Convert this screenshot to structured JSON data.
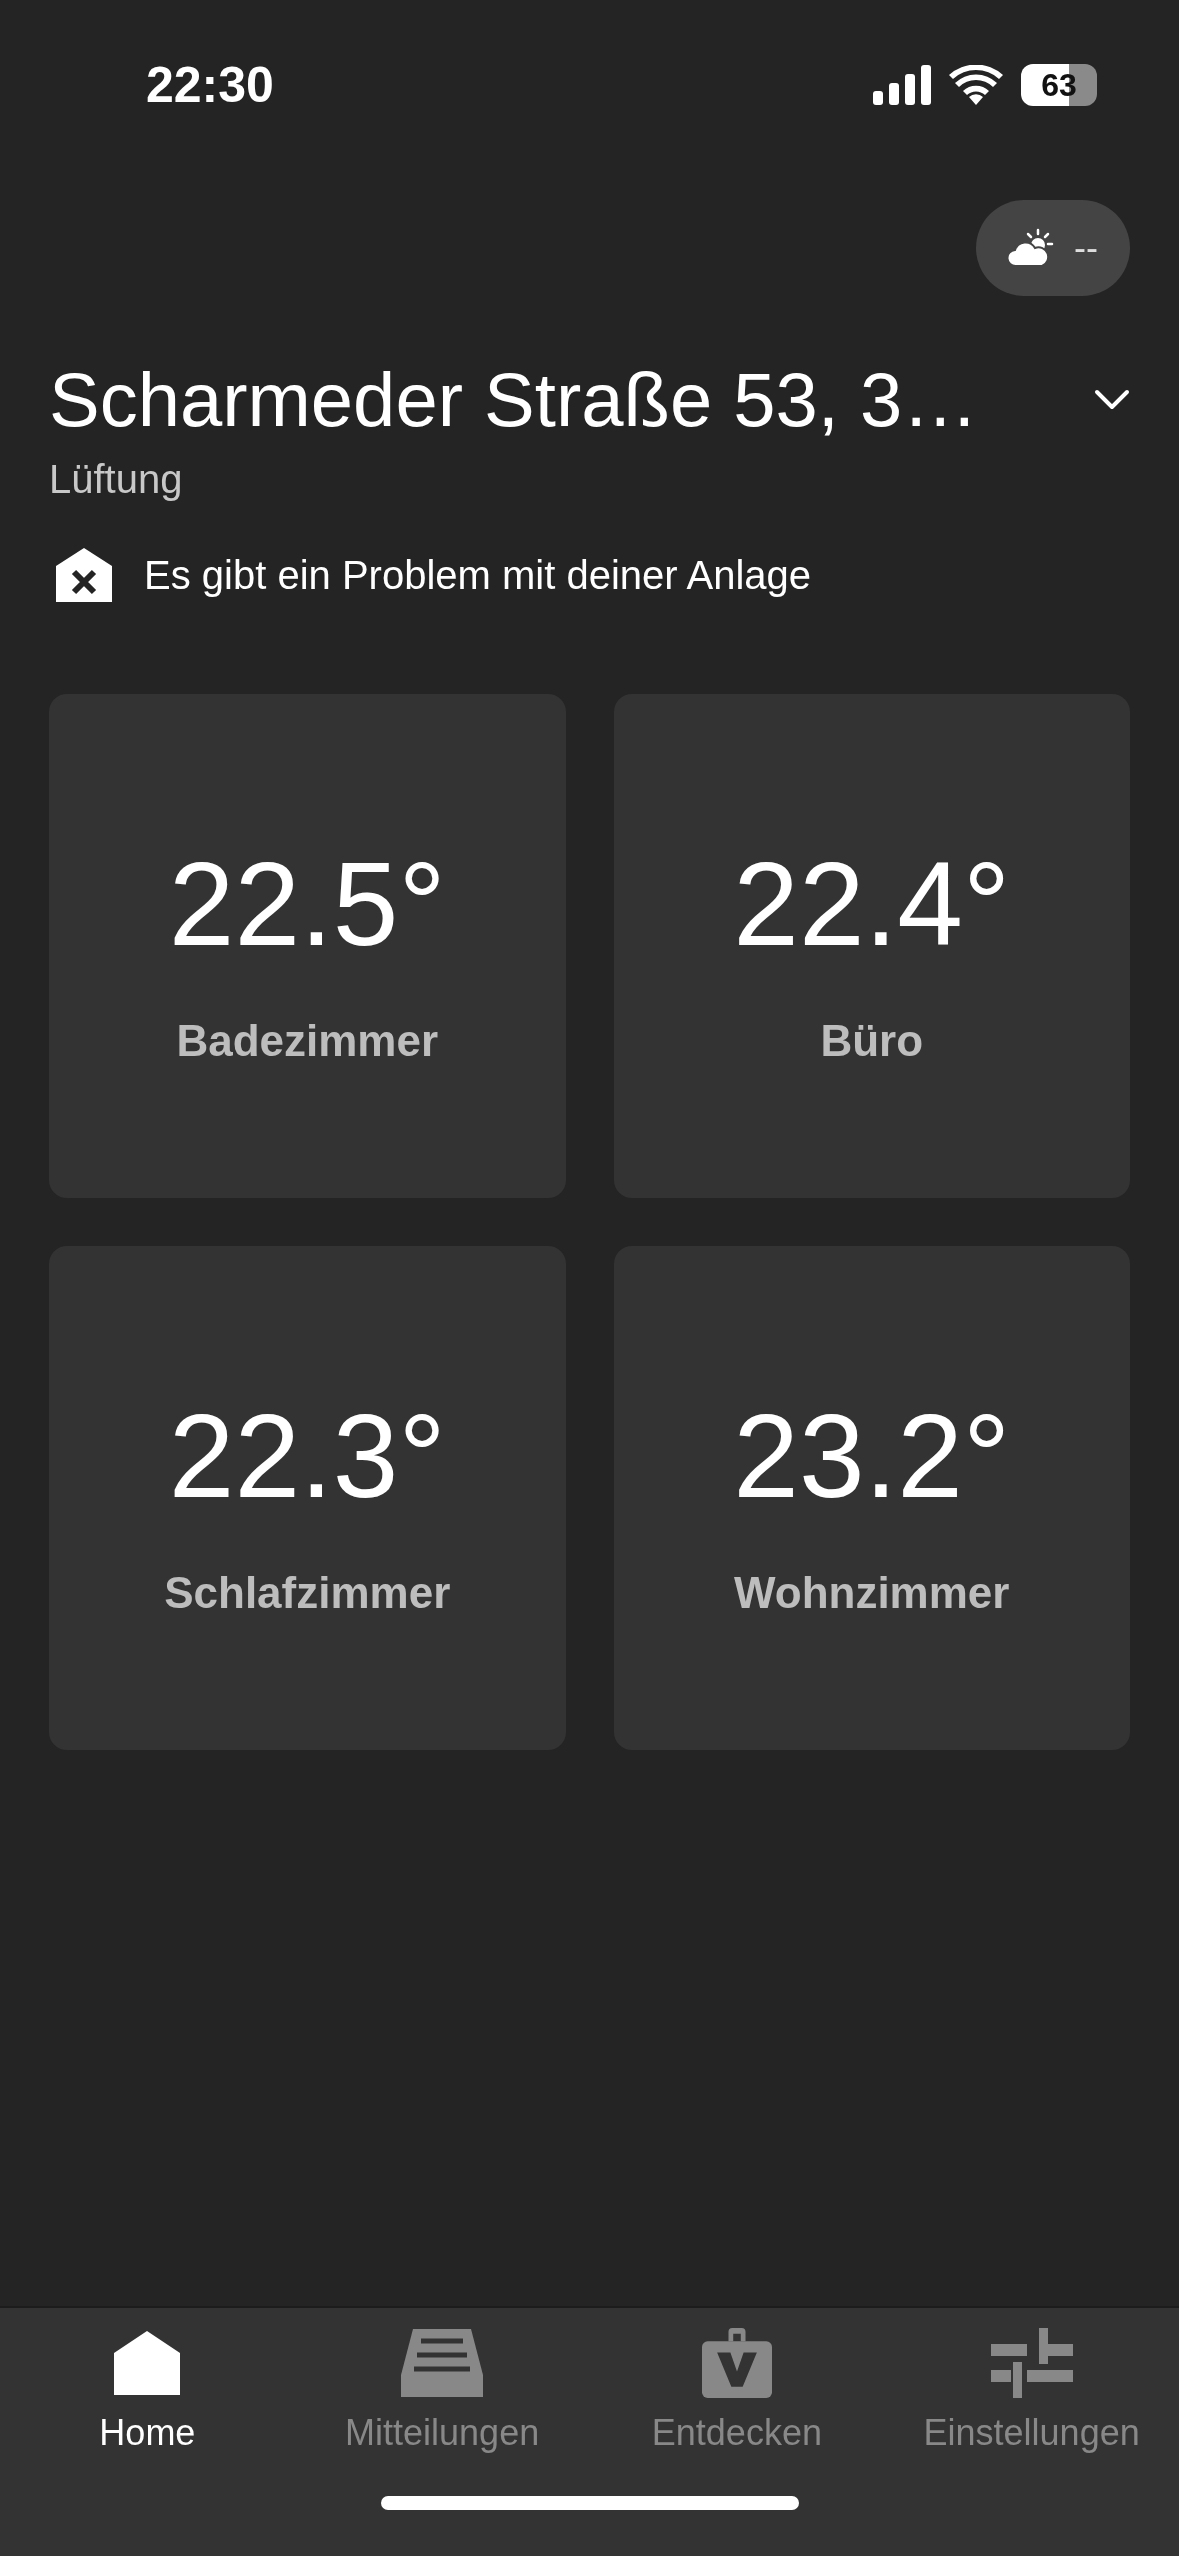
{
  "status_bar": {
    "time": "22:30",
    "battery": "63"
  },
  "weather": {
    "reading": "--"
  },
  "header": {
    "title": "Scharmeder Straße 53, 3…",
    "subtitle": "Lüftung"
  },
  "alert": {
    "text": "Es gibt ein Problem mit deiner Anlage"
  },
  "rooms": [
    {
      "temperature": "22.5°",
      "name": "Badezimmer"
    },
    {
      "temperature": "22.4°",
      "name": "Büro"
    },
    {
      "temperature": "22.3°",
      "name": "Schlafzimmer"
    },
    {
      "temperature": "23.2°",
      "name": "Wohnzimmer"
    }
  ],
  "tab_bar": [
    {
      "kind": "home",
      "label": "Home",
      "selected": true
    },
    {
      "kind": "inbox",
      "label": "Mitteilungen",
      "selected": false
    },
    {
      "kind": "bag",
      "label": "Entdecken",
      "selected": false
    },
    {
      "kind": "sliders",
      "label": "Einstellungen",
      "selected": false
    }
  ]
}
